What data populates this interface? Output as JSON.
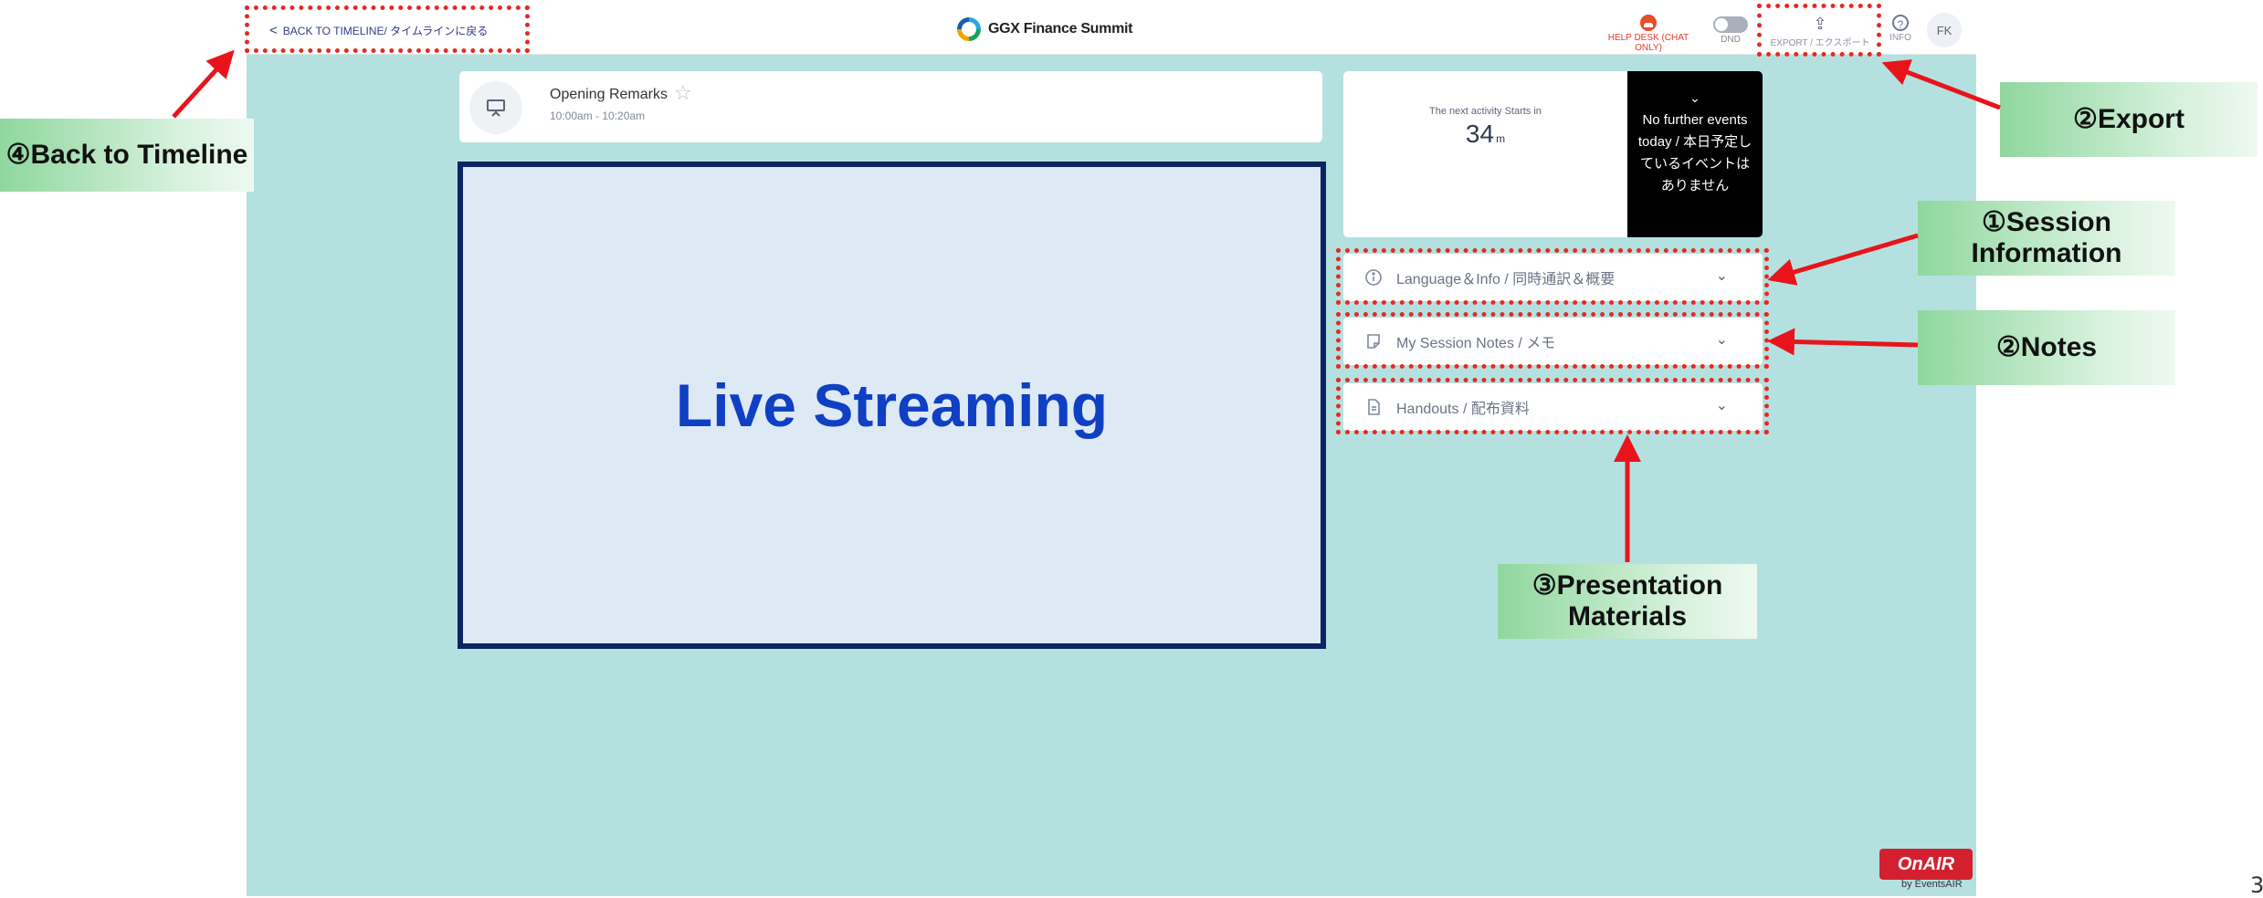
{
  "topbar": {
    "back_link": "BACK TO TIMELINE/ タイムラインに戻る",
    "brand": "GGX Finance Summit",
    "help_desk": "HELP DESK (CHAT ONLY)",
    "dnd": "DND",
    "export": "EXPORT / エクスポート",
    "info": "INFO",
    "avatar": "FK"
  },
  "session": {
    "title": "Opening Remarks",
    "time": "10:00am - 10:20am"
  },
  "video": {
    "label": "Live Streaming"
  },
  "next_activity": {
    "label": "The next activity Starts in",
    "value": "34",
    "unit": "m",
    "message": "No further events today / 本日予定しているイベントはありません"
  },
  "accordion": {
    "info": "Language＆Info / 同時通訳＆概要",
    "notes": "My Session Notes / メモ",
    "handouts": "Handouts / 配布資料"
  },
  "callouts": {
    "back": "④Back to Timeline",
    "export": "②Export",
    "session_info": "①Session Information",
    "notes": "②Notes",
    "materials": "③Presentation Materials"
  },
  "logo": {
    "main": "OnAIR",
    "sub": "by EventsAIR"
  },
  "page_number": "3",
  "colors": {
    "app_background": "#b4e1df",
    "highlight": "#e52a22",
    "video_border": "#0d2461",
    "video_text": "#0f3fc2"
  }
}
